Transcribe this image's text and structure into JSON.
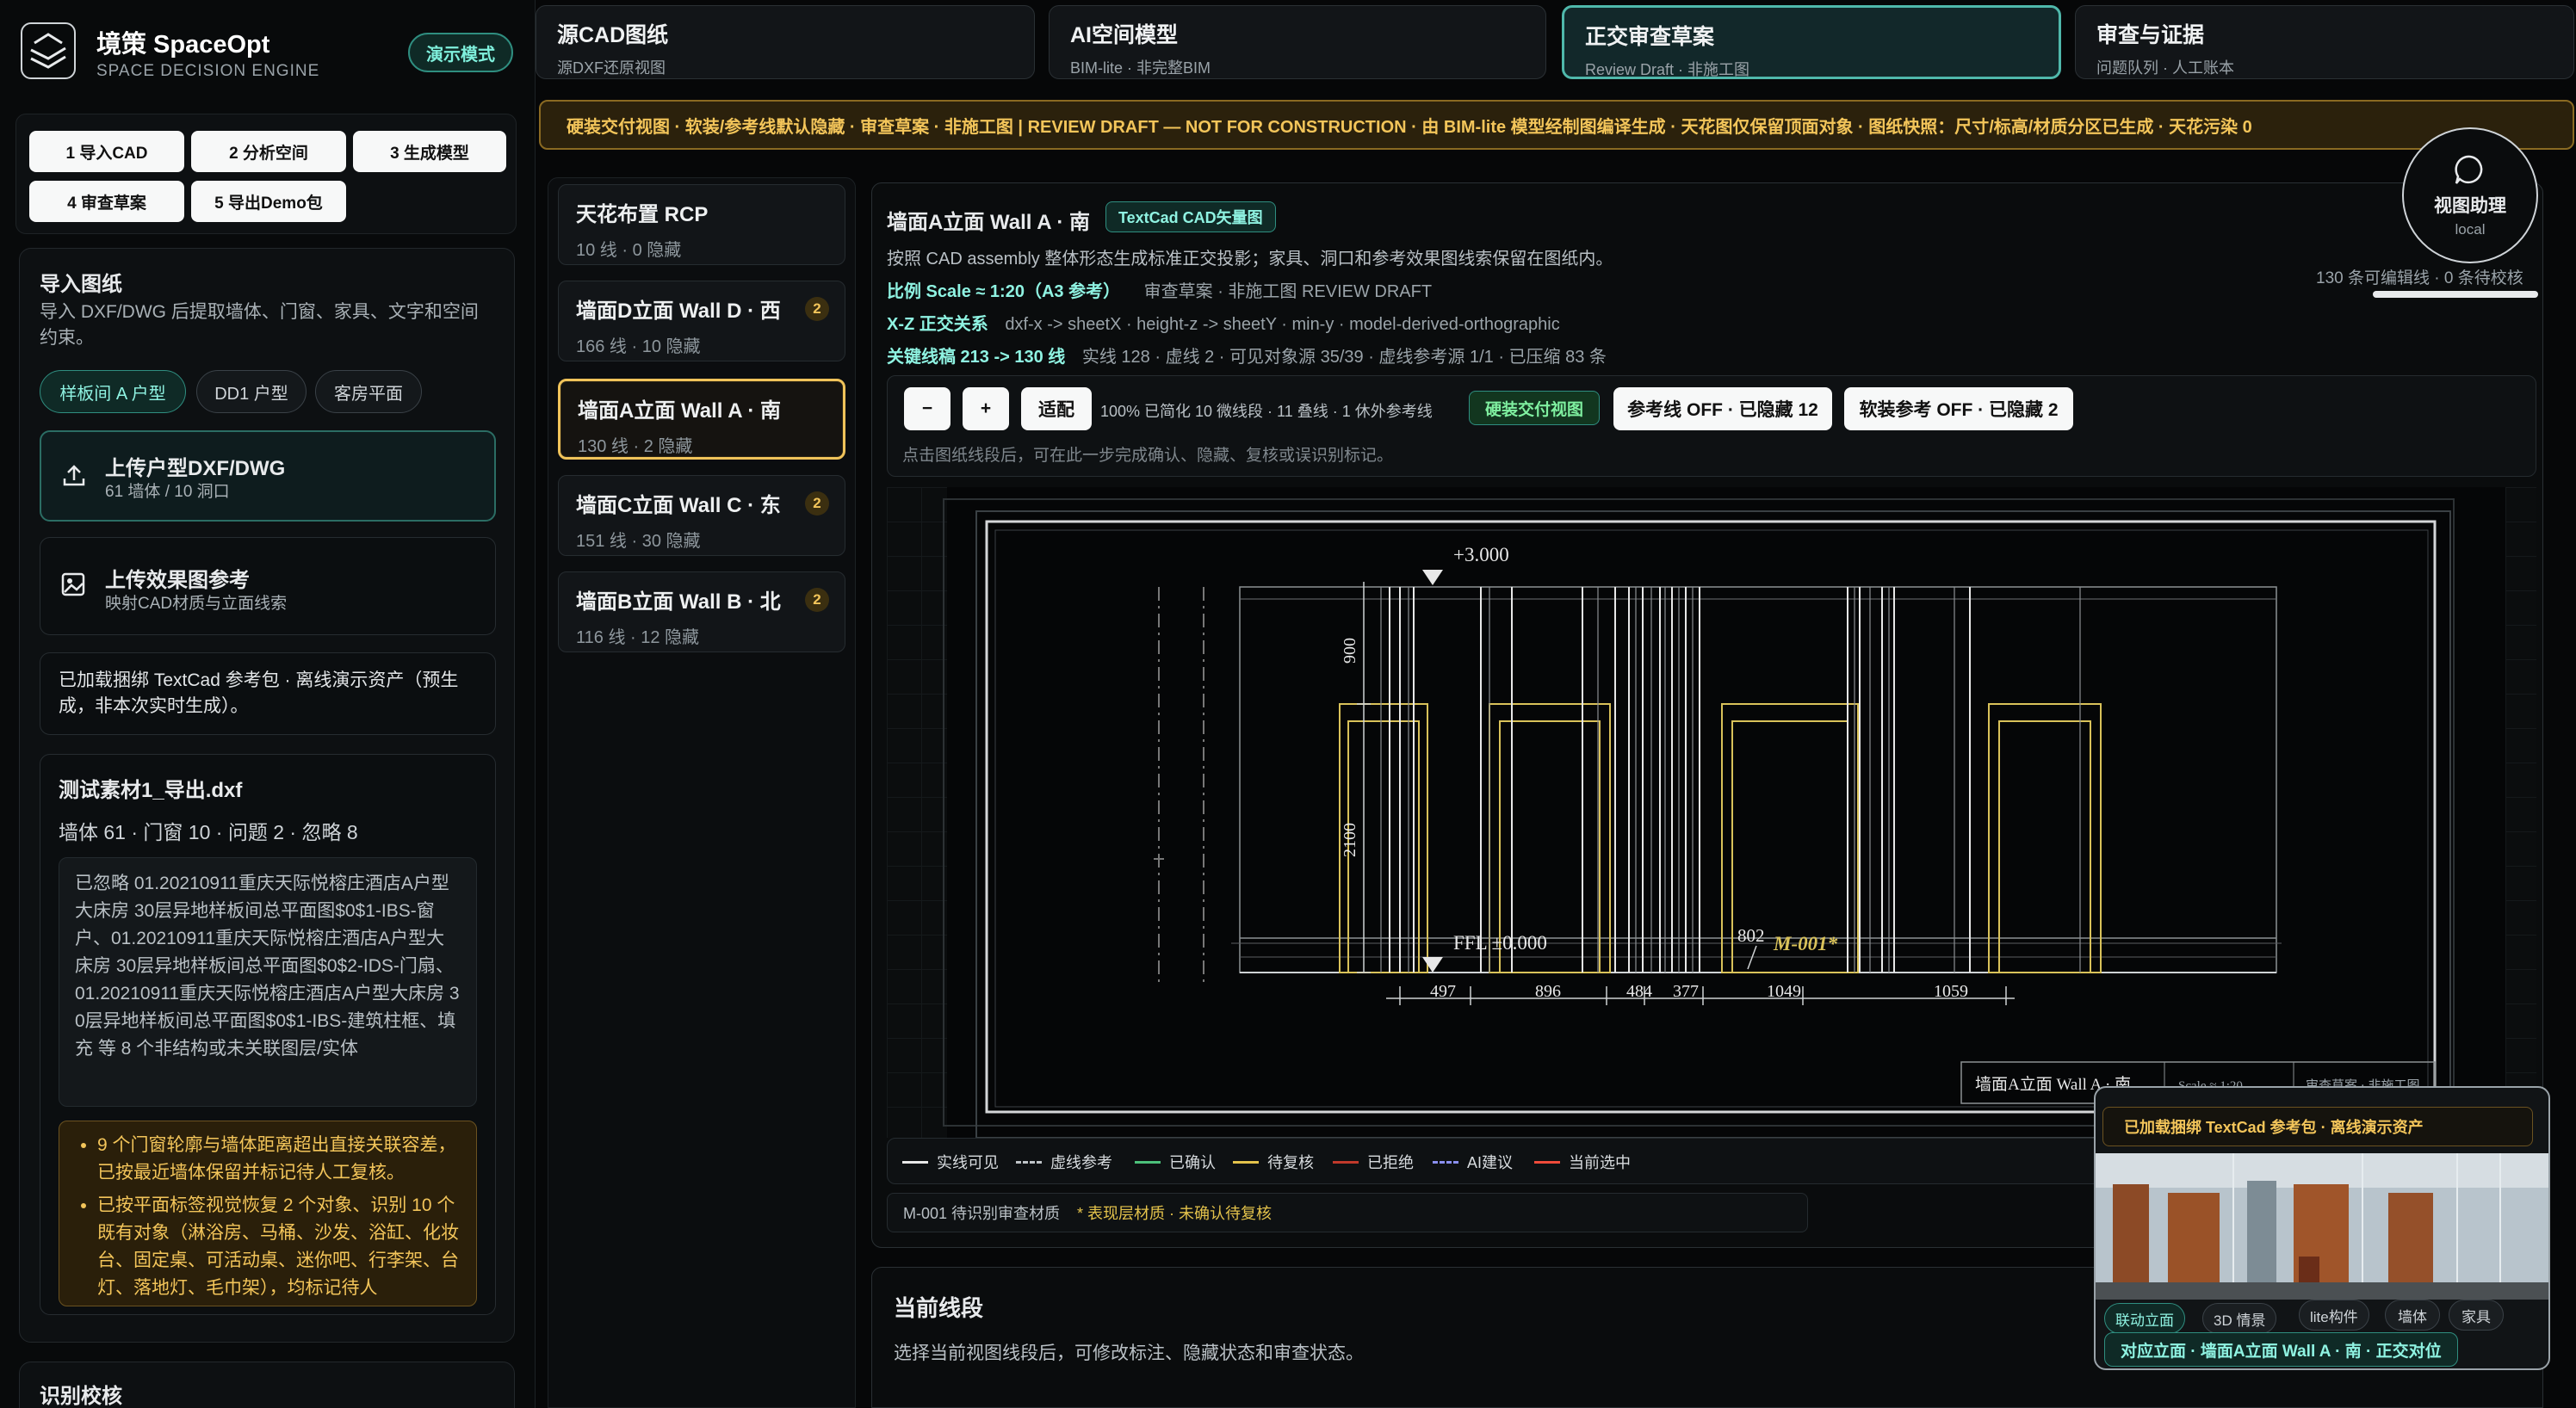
{
  "app": {
    "title": "境策 SpaceOpt",
    "subtitle": "SPACE DECISION ENGINE",
    "mode_badge": "演示模式"
  },
  "tabs": [
    {
      "title": "源CAD图纸",
      "subtitle": "源DXF还原视图"
    },
    {
      "title": "AI空间模型",
      "subtitle": "BIM-lite · 非完整BIM"
    },
    {
      "title": "正交审查草案",
      "subtitle": "Review Draft · 非施工图"
    },
    {
      "title": "审查与证据",
      "subtitle": "问题队列 · 人工账本"
    }
  ],
  "steps": [
    "1 导入CAD",
    "2 分析空间",
    "3 生成模型",
    "4 审查草案",
    "5 导出Demo包"
  ],
  "import": {
    "heading": "导入图纸",
    "description": "导入 DXF/DWG 后提取墙体、门窗、家具、文字和空间约束。",
    "presets": [
      "样板间 A 户型",
      "DD1 户型",
      "客房平面"
    ],
    "upload_cad": {
      "title": "上传户型DXF/DWG",
      "subtitle": "61 墙体 / 10 洞口"
    },
    "upload_ref": {
      "title": "上传效果图参考",
      "subtitle": "映射CAD材质与立面线索"
    },
    "note": "已加载捆绑 TextCad 参考包 · 离线演示资产（预生成，非本次实时生成）。"
  },
  "file": {
    "name": "测试素材1_导出.dxf",
    "stats": "墙体 61 · 门窗 10 · 问题 2 · 忽略 8",
    "ignored": "已忽略 01.20210911重庆天际悦榕庄酒店A户型大床房 30层异地样板间总平面图$0$1-IBS-窗户、01.20210911重庆天际悦榕庄酒店A户型大床房 30层异地样板间总平面图$0$2-IDS-门扇、01.20210911重庆天际悦榕庄酒店A户型大床房 30层异地样板间总平面图$0$1-IBS-建筑柱框、填充 等 8 个非结构或未关联图层/实体",
    "warnings": [
      "9 个门窗轮廓与墙体距离超出直接关联容差，已按最近墙体保留并标记待人工复核。",
      "已按平面标签视觉恢复 2 个对象、识别 10 个既有对象（淋浴房、马桶、沙发、浴缸、化妆台、固定桌、可活动桌、迷你吧、行李架、台灯、落地灯、毛巾架），均标记待人"
    ]
  },
  "next_section": "识别校核",
  "banner": "硬装交付视图 · 软装/参考线默认隐藏 · 审查草案 · 非施工图 | REVIEW DRAFT — NOT FOR CONSTRUCTION · 由 BIM-lite 模型经制图编译生成 · 天花图仅保留顶面对象 · 图纸快照：尺寸/标高/材质分区已生成 · 天花污染 0",
  "views": [
    {
      "title": "天花布置 RCP",
      "subtitle": "10 线 · 0 隐藏",
      "badge": ""
    },
    {
      "title": "墙面D立面 Wall D · 西",
      "subtitle": "166 线 · 10 隐藏",
      "badge": "2"
    },
    {
      "title": "墙面A立面 Wall A · 南",
      "subtitle": "130 线 · 2 隐藏",
      "badge": ""
    },
    {
      "title": "墙面C立面 Wall C · 东",
      "subtitle": "151 线 · 30 隐藏",
      "badge": "2"
    },
    {
      "title": "墙面B立面 Wall B · 北",
      "subtitle": "116 线 · 12 隐藏",
      "badge": "2"
    }
  ],
  "drawing": {
    "title": "墙面A立面 Wall A · 南",
    "tag": "TextCad CAD矢量图",
    "description": "按照 CAD assembly 整体形态生成标准正交投影；家具、洞口和参考效果图线索保留在图纸内。",
    "scale_label": "比例 Scale ≈ 1:20（A3 参考）",
    "scale_note": "审查草案 · 非施工图 REVIEW DRAFT",
    "xz_label": "X-Z 正交关系",
    "xz_text": "dxf-x -> sheetX · height-z -> sheetY · min-y · model-derived-orthographic",
    "key_label": "关键线稿 213 -> 130 线",
    "key_text": "实线 128 · 虚线 2 · 可见对象源 35/39 · 虚线参考源 1/1 · 已压缩 83 条",
    "editable": "130 条可编辑线 · 0 条待校核",
    "progress": 1.0,
    "hint": "点击图纸线段后，可在此一步完成确认、隐藏、复核或误识别标记。",
    "material_note": "M-001 待识别审查材质",
    "material_warn": "* 表现层材质 · 未确认待复核"
  },
  "toolbar": {
    "minus": "−",
    "plus": "+",
    "fit": "适配",
    "zoom_info": "100% 已简化 10 微线段 · 11 叠线 · 1 休外参考线",
    "hard_view": "硬装交付视图",
    "ref_off": "参考线 OFF · 已隐藏 12",
    "soft_off": "软装参考 OFF · 已隐藏 2"
  },
  "cad": {
    "top_level": "+3.000",
    "ffl": "FFL ±0.000",
    "dim_900": "900",
    "dim_2100": "2100",
    "bottom_dims": [
      "497",
      "896",
      "484",
      "377",
      "1049",
      "1059"
    ],
    "tag_802": "802",
    "material_tag": "M-001*",
    "title_block": [
      "墙面A立面 Wall A · 南",
      "Scale ≈ 1:20",
      "审查草案 · 非施工图"
    ]
  },
  "legend": [
    {
      "label": "实线可见",
      "color": "#e8e8e8",
      "style": "solid"
    },
    {
      "label": "虚线参考",
      "color": "#bfc4c8",
      "style": "dashed"
    },
    {
      "label": "已确认",
      "color": "#4cc07a",
      "style": "solid"
    },
    {
      "label": "待复核",
      "color": "#e3c24b",
      "style": "solid"
    },
    {
      "label": "已拒绝",
      "color": "#c0392b",
      "style": "solid"
    },
    {
      "label": "AI建议",
      "color": "#8a8ff0",
      "style": "dashed"
    },
    {
      "label": "当前选中",
      "color": "#ef4b3a",
      "style": "solid"
    }
  ],
  "assistant": {
    "title": "视图助理",
    "sub": "local"
  },
  "current_segment": {
    "title": "当前线段",
    "desc": "选择当前视图线段后，可修改标注、隐藏状态和审查状态。"
  },
  "preview": {
    "banner": "已加载捆绑 TextCad 参考包 · 离线演示资产",
    "chips": [
      "联动立面",
      "3D 情景",
      "lite构件",
      "墙体",
      "家具"
    ],
    "footer": "对应立面 · 墙面A立面 Wall A · 南 · 正交对位"
  },
  "colors": {
    "accent": "#5fd6c4",
    "warn": "#f3c55a",
    "cad_yellow": "#d9c25a"
  }
}
